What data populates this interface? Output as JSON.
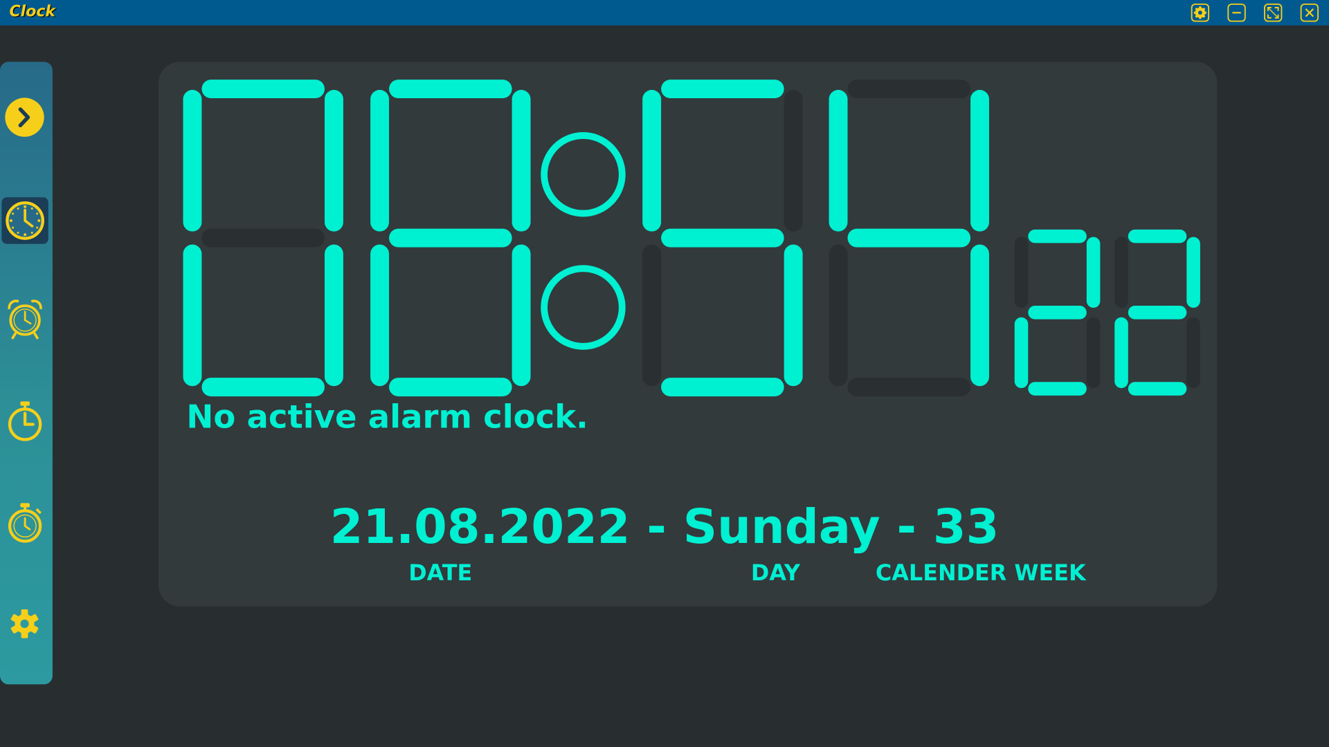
{
  "window": {
    "title": "Clock",
    "buttons": [
      "settings-icon",
      "minimize-icon",
      "maximize-icon",
      "close-icon"
    ]
  },
  "sidebar": {
    "items": [
      {
        "name": "expand",
        "icon": "chevron-right-icon"
      },
      {
        "name": "clock",
        "icon": "clock-icon",
        "active": true
      },
      {
        "name": "alarm",
        "icon": "alarm-clock-icon"
      },
      {
        "name": "timer",
        "icon": "timer-icon"
      },
      {
        "name": "stopwatch",
        "icon": "stopwatch-icon"
      },
      {
        "name": "settings",
        "icon": "gear-icon"
      }
    ]
  },
  "clock": {
    "hours": "08",
    "minutes": "54",
    "seconds": "22"
  },
  "alarm_status": "No active alarm clock.",
  "date": {
    "date": "21.08.2022",
    "separator": " - ",
    "day": "Sunday",
    "week": "33",
    "labels": {
      "date": "DATE",
      "day": "DAY",
      "week": "CALENDER WEEK"
    }
  },
  "colors": {
    "accent": "#00f0d2",
    "icon_yellow": "#f6cf1a",
    "titlebar": "#005a90",
    "background": "#282e2f",
    "panel": "#323a3c",
    "segment_off": "#2a3032"
  }
}
